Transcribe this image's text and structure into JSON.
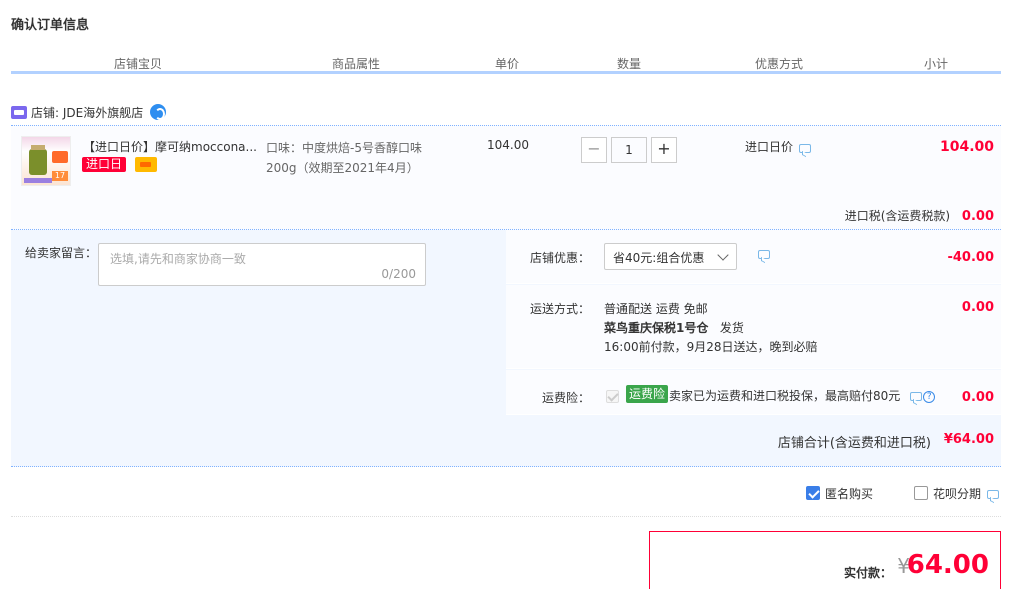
{
  "page_title": "确认订单信息",
  "columns": [
    "店铺宝贝",
    "商品属性",
    "单价",
    "数量",
    "优惠方式",
    "小计"
  ],
  "store": {
    "label": "店铺: JDE海外旗舰店"
  },
  "item": {
    "title": "【进口日价】摩可纳moccona...",
    "badge": "进口日",
    "attr": "口味：中度烘焙-5号香醇口味200g（效期至2021年4月）",
    "unit_price": "104.00",
    "quantity": "1",
    "promo": "进口日价",
    "subtotal": "104.00",
    "thumb_tag": "17"
  },
  "tax": {
    "label": "进口税(含运费税款)",
    "value": "0.00"
  },
  "memo": {
    "label": "给卖家留言：",
    "placeholder": "选填,请先和商家协商一致",
    "count": "0/200"
  },
  "discount": {
    "label": "店铺优惠：",
    "selected": "省40元:组合优惠",
    "value": "-40.00"
  },
  "shipping": {
    "label": "运送方式：",
    "line1": "普通配送 运费 免邮",
    "warehouse": "菜鸟重庆保税1号仓",
    "dispatch": "发货",
    "line3": "16:00前付款，9月28日送达，晚到必赔",
    "value": "0.00"
  },
  "insurance": {
    "label": "运费险：",
    "badge": "运费险",
    "text": "卖家已为运费和进口税投保，最高赔付80元",
    "value": "0.00"
  },
  "store_total": {
    "label": "店铺合计(含运费和进口税)",
    "value": "¥64.00"
  },
  "options": {
    "anonymous": "匿名购买",
    "huabei": "花呗分期"
  },
  "payment": {
    "label": "实付款：",
    "yen": "¥",
    "amount": "64.00"
  },
  "colors": {
    "accent": "#ff0036",
    "blue": "#3a7ee8",
    "panel": "#f2f7ff",
    "header_line": "#b2d1ff"
  }
}
